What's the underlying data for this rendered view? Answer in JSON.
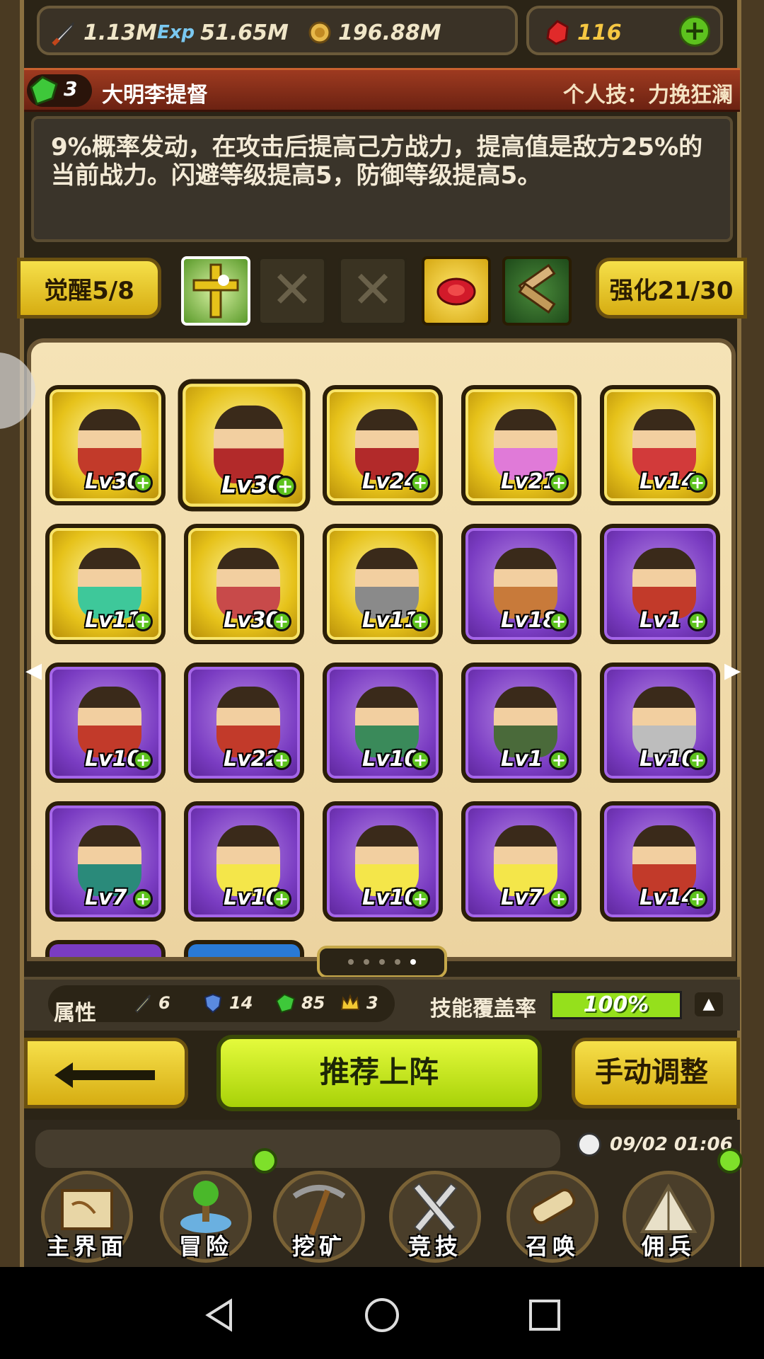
{
  "resources": {
    "attack": {
      "value": "1.13M",
      "icon": "sword-icon"
    },
    "exp": {
      "value": "51.65M",
      "icon": "exp-icon",
      "label": "Exp"
    },
    "coin": {
      "value": "196.88M",
      "icon": "coin-icon"
    },
    "gem": {
      "value": "116",
      "icon": "ruby-icon"
    },
    "add_label": "+"
  },
  "hero": {
    "rank": "3",
    "name": "大明李提督",
    "skill_label": "个人技：力挽狂澜",
    "description": "9%概率发动，在攻击后提高己方战力，提高值是敌方25%的当前战力。闪避等级提高5，防御等级提高5。"
  },
  "awaken": {
    "label": "觉醒5/8",
    "enhance_label": "强化21/30",
    "empty_mark": "✕"
  },
  "heroes": [
    [
      {
        "lv": "Lv30",
        "rarity": "gold",
        "color": "#c23a2a"
      },
      {
        "lv": "Lv30",
        "rarity": "gold",
        "color": "#b22a2a"
      },
      {
        "lv": "Lv24",
        "rarity": "gold",
        "color": "#b22a2a"
      },
      {
        "lv": "Lv21",
        "rarity": "gold",
        "color": "#e07ad8"
      },
      {
        "lv": "Lv14",
        "rarity": "gold",
        "color": "#d23a3a"
      }
    ],
    [
      {
        "lv": "Lv11",
        "rarity": "gold",
        "color": "#3ec89a"
      },
      {
        "lv": "Lv30",
        "rarity": "gold",
        "color": "#c84a4a"
      },
      {
        "lv": "Lv11",
        "rarity": "gold",
        "color": "#8a8a8a"
      },
      {
        "lv": "Lv18",
        "rarity": "purple",
        "color": "#c87a3a"
      },
      {
        "lv": "Lv1",
        "rarity": "purple",
        "color": "#c23a2a"
      }
    ],
    [
      {
        "lv": "Lv10",
        "rarity": "purple",
        "color": "#c23a2a"
      },
      {
        "lv": "Lv22",
        "rarity": "purple",
        "color": "#c23a2a"
      },
      {
        "lv": "Lv10",
        "rarity": "purple",
        "color": "#3a8a5a"
      },
      {
        "lv": "Lv1",
        "rarity": "purple",
        "color": "#4a6a3a"
      },
      {
        "lv": "Lv10",
        "rarity": "purple",
        "color": "#bdbdbd"
      }
    ],
    [
      {
        "lv": "Lv7",
        "rarity": "purple",
        "color": "#2a8a7a"
      },
      {
        "lv": "Lv10",
        "rarity": "purple",
        "color": "#f4e64a"
      },
      {
        "lv": "Lv10",
        "rarity": "purple",
        "color": "#f4e64a"
      },
      {
        "lv": "Lv7",
        "rarity": "purple",
        "color": "#f4e64a"
      },
      {
        "lv": "Lv14",
        "rarity": "purple",
        "color": "#c23a2a"
      }
    ]
  ],
  "stats": {
    "label": "属性",
    "items": [
      {
        "value": "6",
        "icon": "sword-icon"
      },
      {
        "value": "14",
        "icon": "shield-icon"
      },
      {
        "value": "85",
        "icon": "gem-icon"
      },
      {
        "value": "3",
        "icon": "crown-icon"
      }
    ],
    "coverage_label": "技能覆盖率",
    "coverage_value": "100%",
    "coverage_fraction": 1.0
  },
  "actions": {
    "recommend": "推荐上阵",
    "manual": "手动调整"
  },
  "nav": {
    "datetime": "09/02 01:06",
    "items": [
      {
        "label": "主界面",
        "icon": "scroll-map-icon"
      },
      {
        "label": "冒险",
        "icon": "island-icon"
      },
      {
        "label": "挖矿",
        "icon": "pickaxe-icon"
      },
      {
        "label": "竞技",
        "icon": "crossed-swords-icon"
      },
      {
        "label": "召唤",
        "icon": "summon-scroll-icon"
      },
      {
        "label": "佣兵",
        "icon": "tent-icon"
      }
    ]
  },
  "colors": {
    "accent_green": "#95e01c",
    "gold": "#e6c21a",
    "purple": "#7a3cc2"
  }
}
